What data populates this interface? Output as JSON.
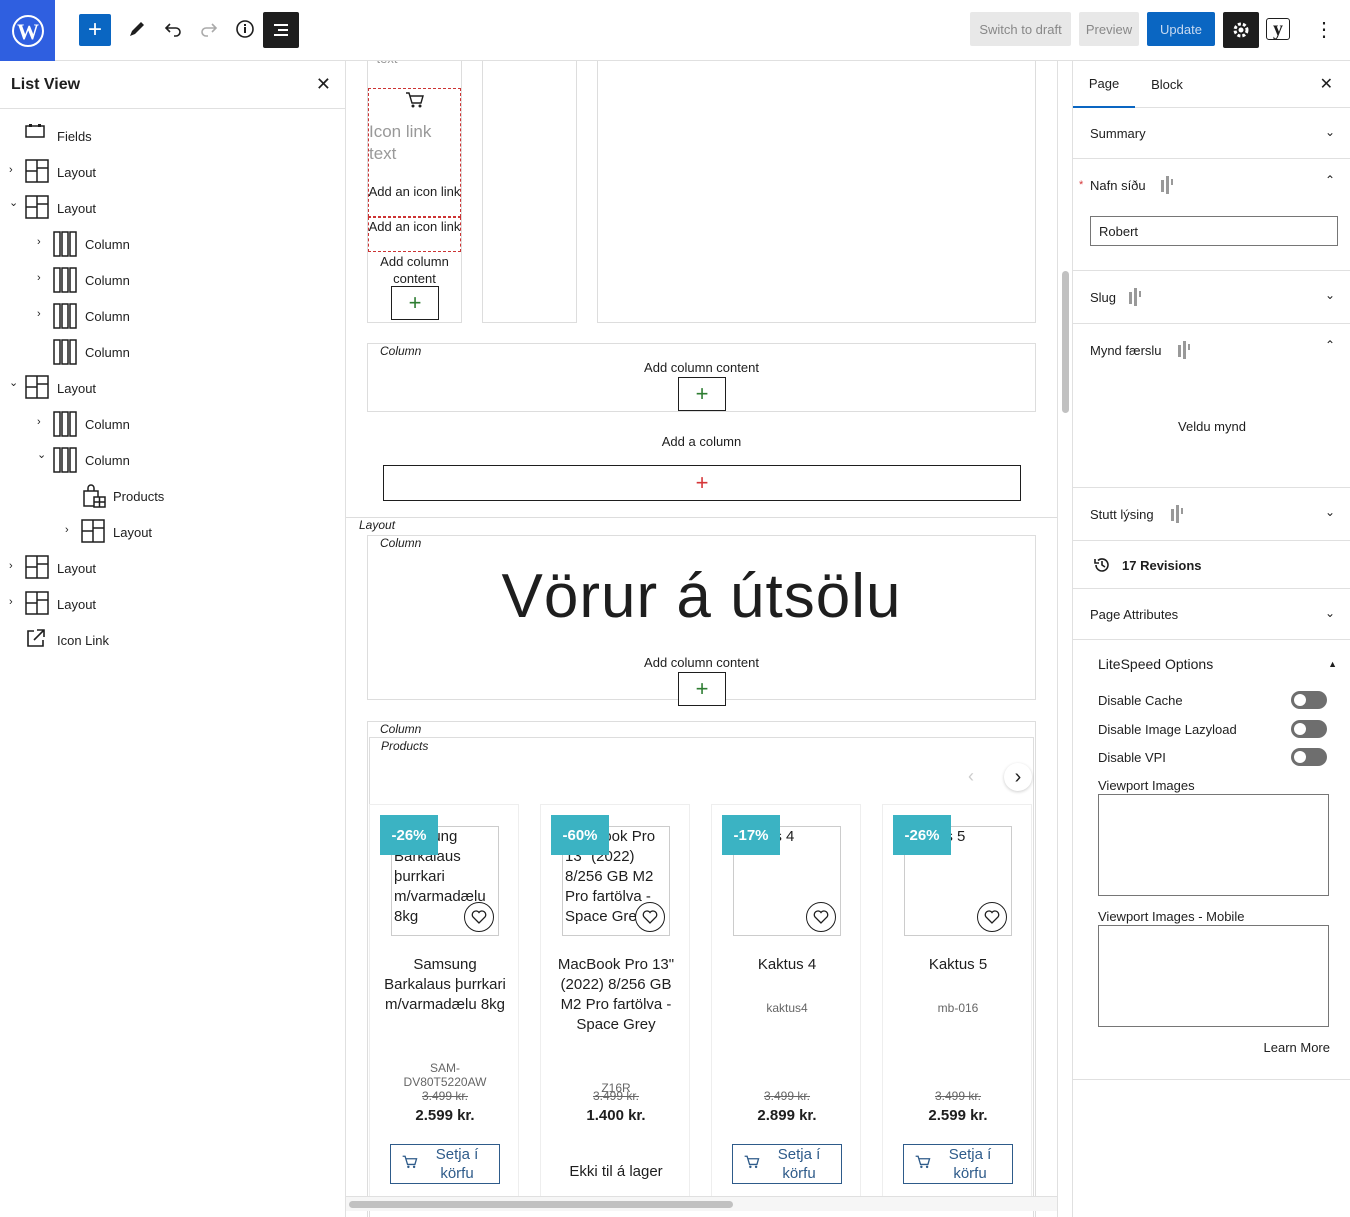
{
  "toolbar": {
    "switch_draft": "Switch to draft",
    "preview": "Preview",
    "update": "Update",
    "yoast": "y"
  },
  "list_view": {
    "title": "List View",
    "items": [
      {
        "label": "Fields"
      },
      {
        "label": "Layout"
      },
      {
        "label": "Layout"
      },
      {
        "label": "Column"
      },
      {
        "label": "Column"
      },
      {
        "label": "Column"
      },
      {
        "label": "Column"
      },
      {
        "label": "Layout"
      },
      {
        "label": "Column"
      },
      {
        "label": "Column"
      },
      {
        "label": "Products"
      },
      {
        "label": "Layout"
      },
      {
        "label": "Layout"
      },
      {
        "label": "Layout"
      },
      {
        "label": "Icon Link"
      }
    ]
  },
  "canvas": {
    "partial_top": "text",
    "icon_link_text": "Icon link text",
    "add_icon_link_1": "Add an icon link",
    "add_icon_link_2": "Add an icon link",
    "add_column_content": "Add column content",
    "column_label": "Column",
    "add_column_content_2": "Add column content",
    "add_a_column": "Add a column",
    "layout_label": "Layout",
    "column_label_2": "Column",
    "heading": "Vörur á útsölu",
    "add_column_content_3": "Add column content",
    "column_label_3": "Column",
    "products_label": "Products",
    "products": [
      {
        "badge": "-26%",
        "img_text": "Samsung Barkalaus þurrkari m/varmadælu 8kg",
        "name": "Samsung Barkalaus þurrkari m/varmadælu 8kg",
        "sku": "SAM-DV80T5220AW",
        "old": "3.499 kr.",
        "price": "2.599 kr.",
        "cart": "Setja í körfu"
      },
      {
        "badge": "-60%",
        "img_text": "MacBook Pro 13\" (2022) 8/256 GB M2 Pro fartölva - Space Grey",
        "name": "MacBook Pro 13\" (2022) 8/256 GB M2 Pro fartölva - Space Grey",
        "sku": "Z16R",
        "old": "3.499 kr.",
        "price": "1.400 kr.",
        "cart": "Ekki til á lager"
      },
      {
        "badge": "-17%",
        "img_text": "Kaktus 4",
        "name": "Kaktus 4",
        "sku": "kaktus4",
        "old": "3.499 kr.",
        "price": "2.899 kr.",
        "cart": "Setja í körfu"
      },
      {
        "badge": "-26%",
        "img_text": "Kaktus 5",
        "name": "Kaktus 5",
        "sku": "mb-016",
        "old": "3.499 kr.",
        "price": "2.599 kr.",
        "cart": "Setja í körfu"
      }
    ]
  },
  "sidebar": {
    "tab_page": "Page",
    "tab_block": "Block",
    "summary": "Summary",
    "nafn_label": "Nafn síðu",
    "nafn_value": "Robert",
    "slug": "Slug",
    "mynd": "Mynd færslu",
    "veldu": "Veldu mynd",
    "stutt": "Stutt lýsing",
    "revisions": "17 Revisions",
    "attributes": "Page Attributes",
    "litespeed": "LiteSpeed Options",
    "disable_cache": "Disable Cache",
    "disable_lazy": "Disable Image Lazyload",
    "disable_vpi": "Disable VPI",
    "viewport_images": "Viewport Images",
    "viewport_mobile": "Viewport Images - Mobile",
    "learn_more": "Learn More"
  },
  "colors": {
    "accent": "#0a66c2",
    "badge": "#3bb3c3",
    "wp": "#2f5fe0"
  }
}
